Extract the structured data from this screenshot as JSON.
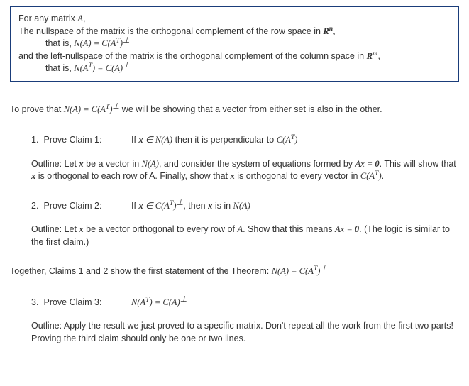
{
  "theorem": {
    "line1_a": "For any matrix ",
    "line1_b": ",",
    "line2_a": "The nullspace of the matrix is the orthogonal complement of the row space in ",
    "line2_b": ",",
    "line3_a": "that is, ",
    "line4_a": "and the left-nullspace of the matrix is the orthogonal complement of the column space in ",
    "line4_b": ",",
    "line5_a": "that is, "
  },
  "intro_a": "To prove that ",
  "intro_b": " we will be showing that a vector from either set is also in the other.",
  "claims": {
    "c1": {
      "num": "1.",
      "label": "Prove Claim 1:",
      "stmt_a": "If ",
      "stmt_b": " then it is perpendicular to ",
      "out_a": "Outline: Let ",
      "out_b": " be a vector in ",
      "out_c": ", and consider the system of equations formed by ",
      "out_d": ". This will show that ",
      "out_e": " is orthogonal to each row of A. Finally, show that ",
      "out_f": " is orthogonal to every vector in ",
      "out_g": "."
    },
    "c2": {
      "num": "2.",
      "label": "Prove Claim 2:",
      "stmt_a": "If ",
      "stmt_b": ", then ",
      "stmt_c": " is in ",
      "out_a": "Outline: Let ",
      "out_b": " be a vector orthogonal to every row of ",
      "out_c": ". Show that this means ",
      "out_d": ". (The logic is similar to the first claim.)"
    },
    "c3": {
      "num": "3.",
      "label": "Prove Claim 3:",
      "out_a": "Outline: Apply the result we just proved to a specific matrix. Don't repeat all the work from the first two parts! Proving the third claim should only be one or two lines."
    }
  },
  "together_a": "Together, Claims 1 and 2 show the first statement of the Theorem:   ",
  "math": {
    "A": "A",
    "Rn_R": "R",
    "Rn_n": "n",
    "Rm_R": "R",
    "Rm_m": "m",
    "NA": "N(A)",
    "eq": " = ",
    "CAT": "C(A",
    "T": "T",
    "close": ")",
    "perp": "⊥",
    "NAT": "N(A",
    "CA": "C(A)",
    "x": "x",
    "in": " ∈ ",
    "Ax": "Ax",
    "zero": "0",
    "Aplain": "A"
  }
}
